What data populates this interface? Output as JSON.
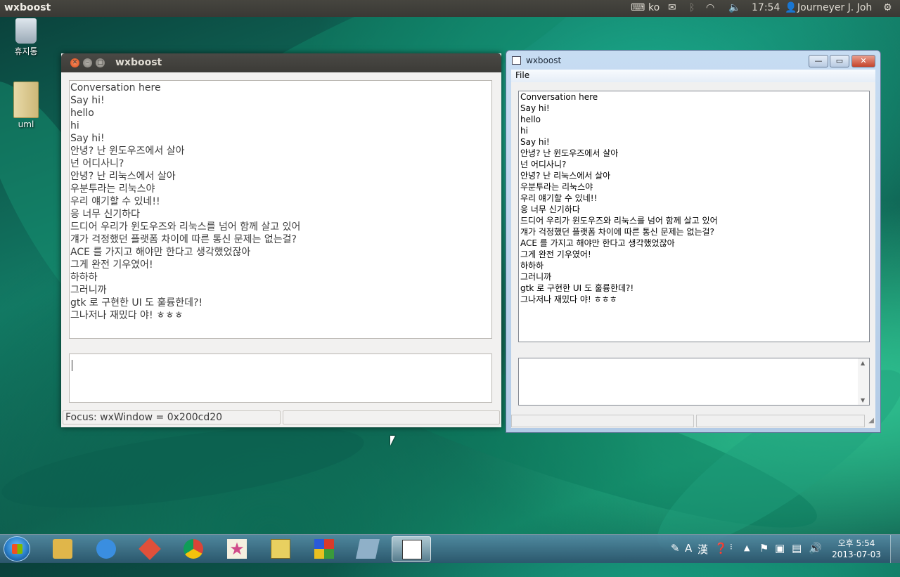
{
  "top_panel": {
    "title": "wxboost",
    "keyboard_layout": "ko",
    "time": "17:54",
    "user": "Journeyer J. Joh"
  },
  "desktop": {
    "icons": [
      {
        "label": "휴지통",
        "icon": "trash-icon"
      },
      {
        "label": "uml",
        "icon": "folder-icon"
      }
    ]
  },
  "ubuntu_window": {
    "title": "wxboost",
    "conversation": [
      "Conversation here",
      "Say hi!",
      "hello",
      "hi",
      "Say hi!",
      "안녕? 난 윈도우즈에서 살아",
      "넌 어디사니?",
      "안녕? 난 리눅스에서 살아",
      "우분투라는 리눅스야",
      "우리 얘기할 수 있네!!",
      "응 너무 신기하다",
      "드디어 우리가 윈도우즈와 리눅스를 넘어 함께 살고 있어",
      "걔가 걱정했던 플랫폼 차이에 따른 통신 문제는 없는걸?",
      "ACE 를 가지고 해야만 한다고 생각했었잖아",
      "그게 완전 기우였어!",
      "하하하",
      "그러니까",
      "gtk 로 구현한 UI 도 훌륭한데?!",
      "그나저나 재밌다 야! ㅎㅎㅎ"
    ],
    "status_focus": "Focus: wxWindow = 0x200cd20"
  },
  "windows_window": {
    "title": "wxboost",
    "menu": [
      "File"
    ],
    "conversation": [
      "Conversation here",
      "Say hi!",
      "hello",
      "hi",
      "Say hi!",
      "안녕? 난 윈도우즈에서 살아",
      "넌 어디사니?",
      "안녕? 난 리눅스에서 살아",
      "우분투라는 리눅스야",
      "우리 얘기할 수 있네!!",
      "응 너무 신기하다",
      "드디어 우리가 윈도우즈와 리눅스를 넘어 함께 살고 있어",
      "걔가 걱정했던 플랫폼 차이에 따른 통신 문제는 없는걸?",
      "ACE 를 가지고 해야만 한다고 생각했었잖아",
      "그게 완전 기우였어!",
      "하하하",
      "그러니까",
      "gtk 로 구현한 UI 도 훌륭한데?!",
      "그나저나 재밌다 야! ㅎㅎㅎ"
    ]
  },
  "taskbar": {
    "apps": [
      {
        "name": "file-explorer-icon",
        "color": "#e0b64a"
      },
      {
        "name": "internet-explorer-icon",
        "color": "#3a8ee0"
      },
      {
        "name": "git-icon",
        "color": "#e0503a"
      },
      {
        "name": "chrome-icon",
        "color": "#d8c030"
      },
      {
        "name": "starred-app-icon",
        "color": "#d04a8a"
      },
      {
        "name": "program-icon",
        "color": "#e8d060"
      },
      {
        "name": "colorful-app-icon",
        "color": "#3a9a3a"
      },
      {
        "name": "notes-app-icon",
        "color": "#8fb0c8"
      },
      {
        "name": "wxboost-taskbar-icon",
        "color": "#ffffff"
      }
    ],
    "tray_ime_a": "A",
    "tray_ime_han": "漢",
    "clock_time": "오후 5:54",
    "clock_date": "2013-07-03"
  }
}
